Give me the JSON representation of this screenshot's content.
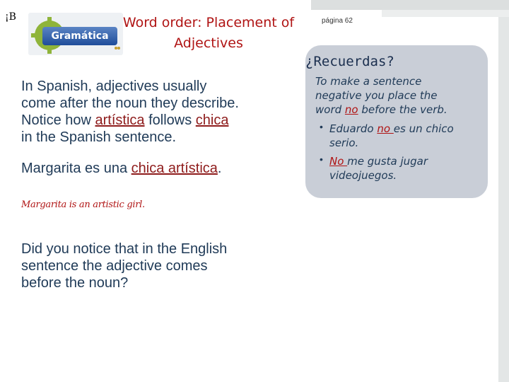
{
  "slide_mark": "¡B",
  "logo": {
    "label": "Gramática"
  },
  "title": {
    "line1": "Word order:  Placement of",
    "line2": "Adjectives"
  },
  "page_ref": "página 62",
  "main": {
    "para1": {
      "line1": "In Spanish, adjectives usually",
      "line2": "come after the noun they describe.",
      "line3_before": "Notice how ",
      "line3_word1": "artística",
      "line3_mid": " follows ",
      "line3_word2": "chica",
      "line4": "in the Spanish sentence."
    },
    "example": {
      "before": "Margarita es una ",
      "underlined": "chica artística",
      "after": "."
    },
    "translation": "Margarita is an artistic girl.",
    "para2": {
      "line1": "Did you notice that in the English",
      "line2": "sentence the adjective comes",
      "line3": "before the noun?"
    }
  },
  "callout": {
    "title": "¿Recuerdas?",
    "line1": "To make a sentence",
    "line2": "negative you place the",
    "line3_before": "word ",
    "line3_word": "no",
    "line3_after": " before the verb.",
    "bullets": [
      {
        "before": "Eduardo ",
        "word": "no ",
        "after": "es un chico serio."
      },
      {
        "before": "",
        "word": "No ",
        "after": "me gusta jugar videojuegos."
      }
    ]
  },
  "colors": {
    "title": "#b01414",
    "body_text": "#1f3a57",
    "callout_bg": "#c9ced7"
  }
}
